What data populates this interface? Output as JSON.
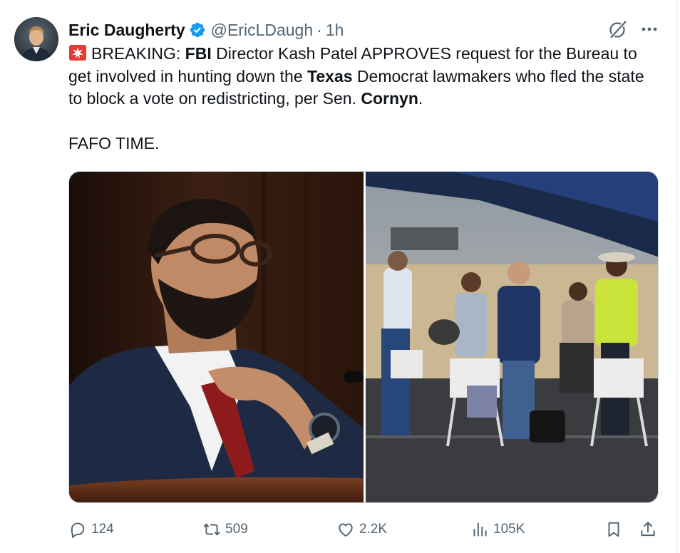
{
  "tweet": {
    "author_name": "Eric Daugherty",
    "handle": "@EricLDaugh",
    "separator": "·",
    "time": "1h",
    "text": {
      "line1_prefix": "BREAKING: ",
      "line1_bold1": "FBI",
      "line1_mid": " Director Kash Patel APPROVES request for the Bureau to get involved in hunting down the ",
      "line1_bold2": "Texas",
      "line1_mid2": " Democrat lawmakers who fled the state to block a vote on redistricting, per Sen. ",
      "line1_bold3": "Cornyn",
      "line1_end": ".",
      "line2": "FAFO TIME."
    },
    "icons": {
      "siren": "police-light-emoji",
      "verified": "verified-badge-icon",
      "grok": "grok-icon",
      "more": "more-icon"
    }
  },
  "actions": {
    "replies": "124",
    "reposts": "509",
    "likes": "2.2K",
    "views": "105K"
  },
  "colors": {
    "accent": "#1d9bf0",
    "text": "#0f1419",
    "muted": "#536471"
  }
}
